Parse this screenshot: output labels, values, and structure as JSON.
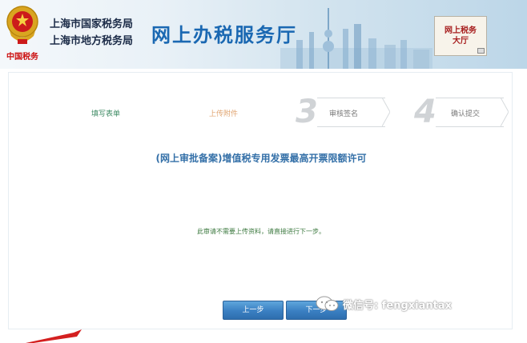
{
  "header": {
    "emblem_caption": "中国税务",
    "bureau_line1": "上海市国家税务局",
    "bureau_line2": "上海市地方税务局",
    "hall_title": "网上办税服务厅",
    "badge_line1": "网上税务",
    "badge_line2": "大厅"
  },
  "steps": {
    "step1": "填写表单",
    "step2": "上传附件",
    "step3_number": "3",
    "step3": "审核签名",
    "step4_number": "4",
    "step4": "确认提交"
  },
  "form": {
    "title": "(网上审批备案)增值税专用发票最高开票限额许可",
    "notice": "此审请不需要上传资料，请直接进行下一步。"
  },
  "buttons": {
    "prev": "上一步",
    "next": "下一步"
  },
  "watermark": {
    "text": "微信号: fengxiantax"
  },
  "colors": {
    "brand_blue": "#1a68b2",
    "title_blue": "#3470a8",
    "step_active_green": "#3d8a63",
    "step_current_orange": "#e0a470",
    "button_blue": "#3a7fc2"
  }
}
